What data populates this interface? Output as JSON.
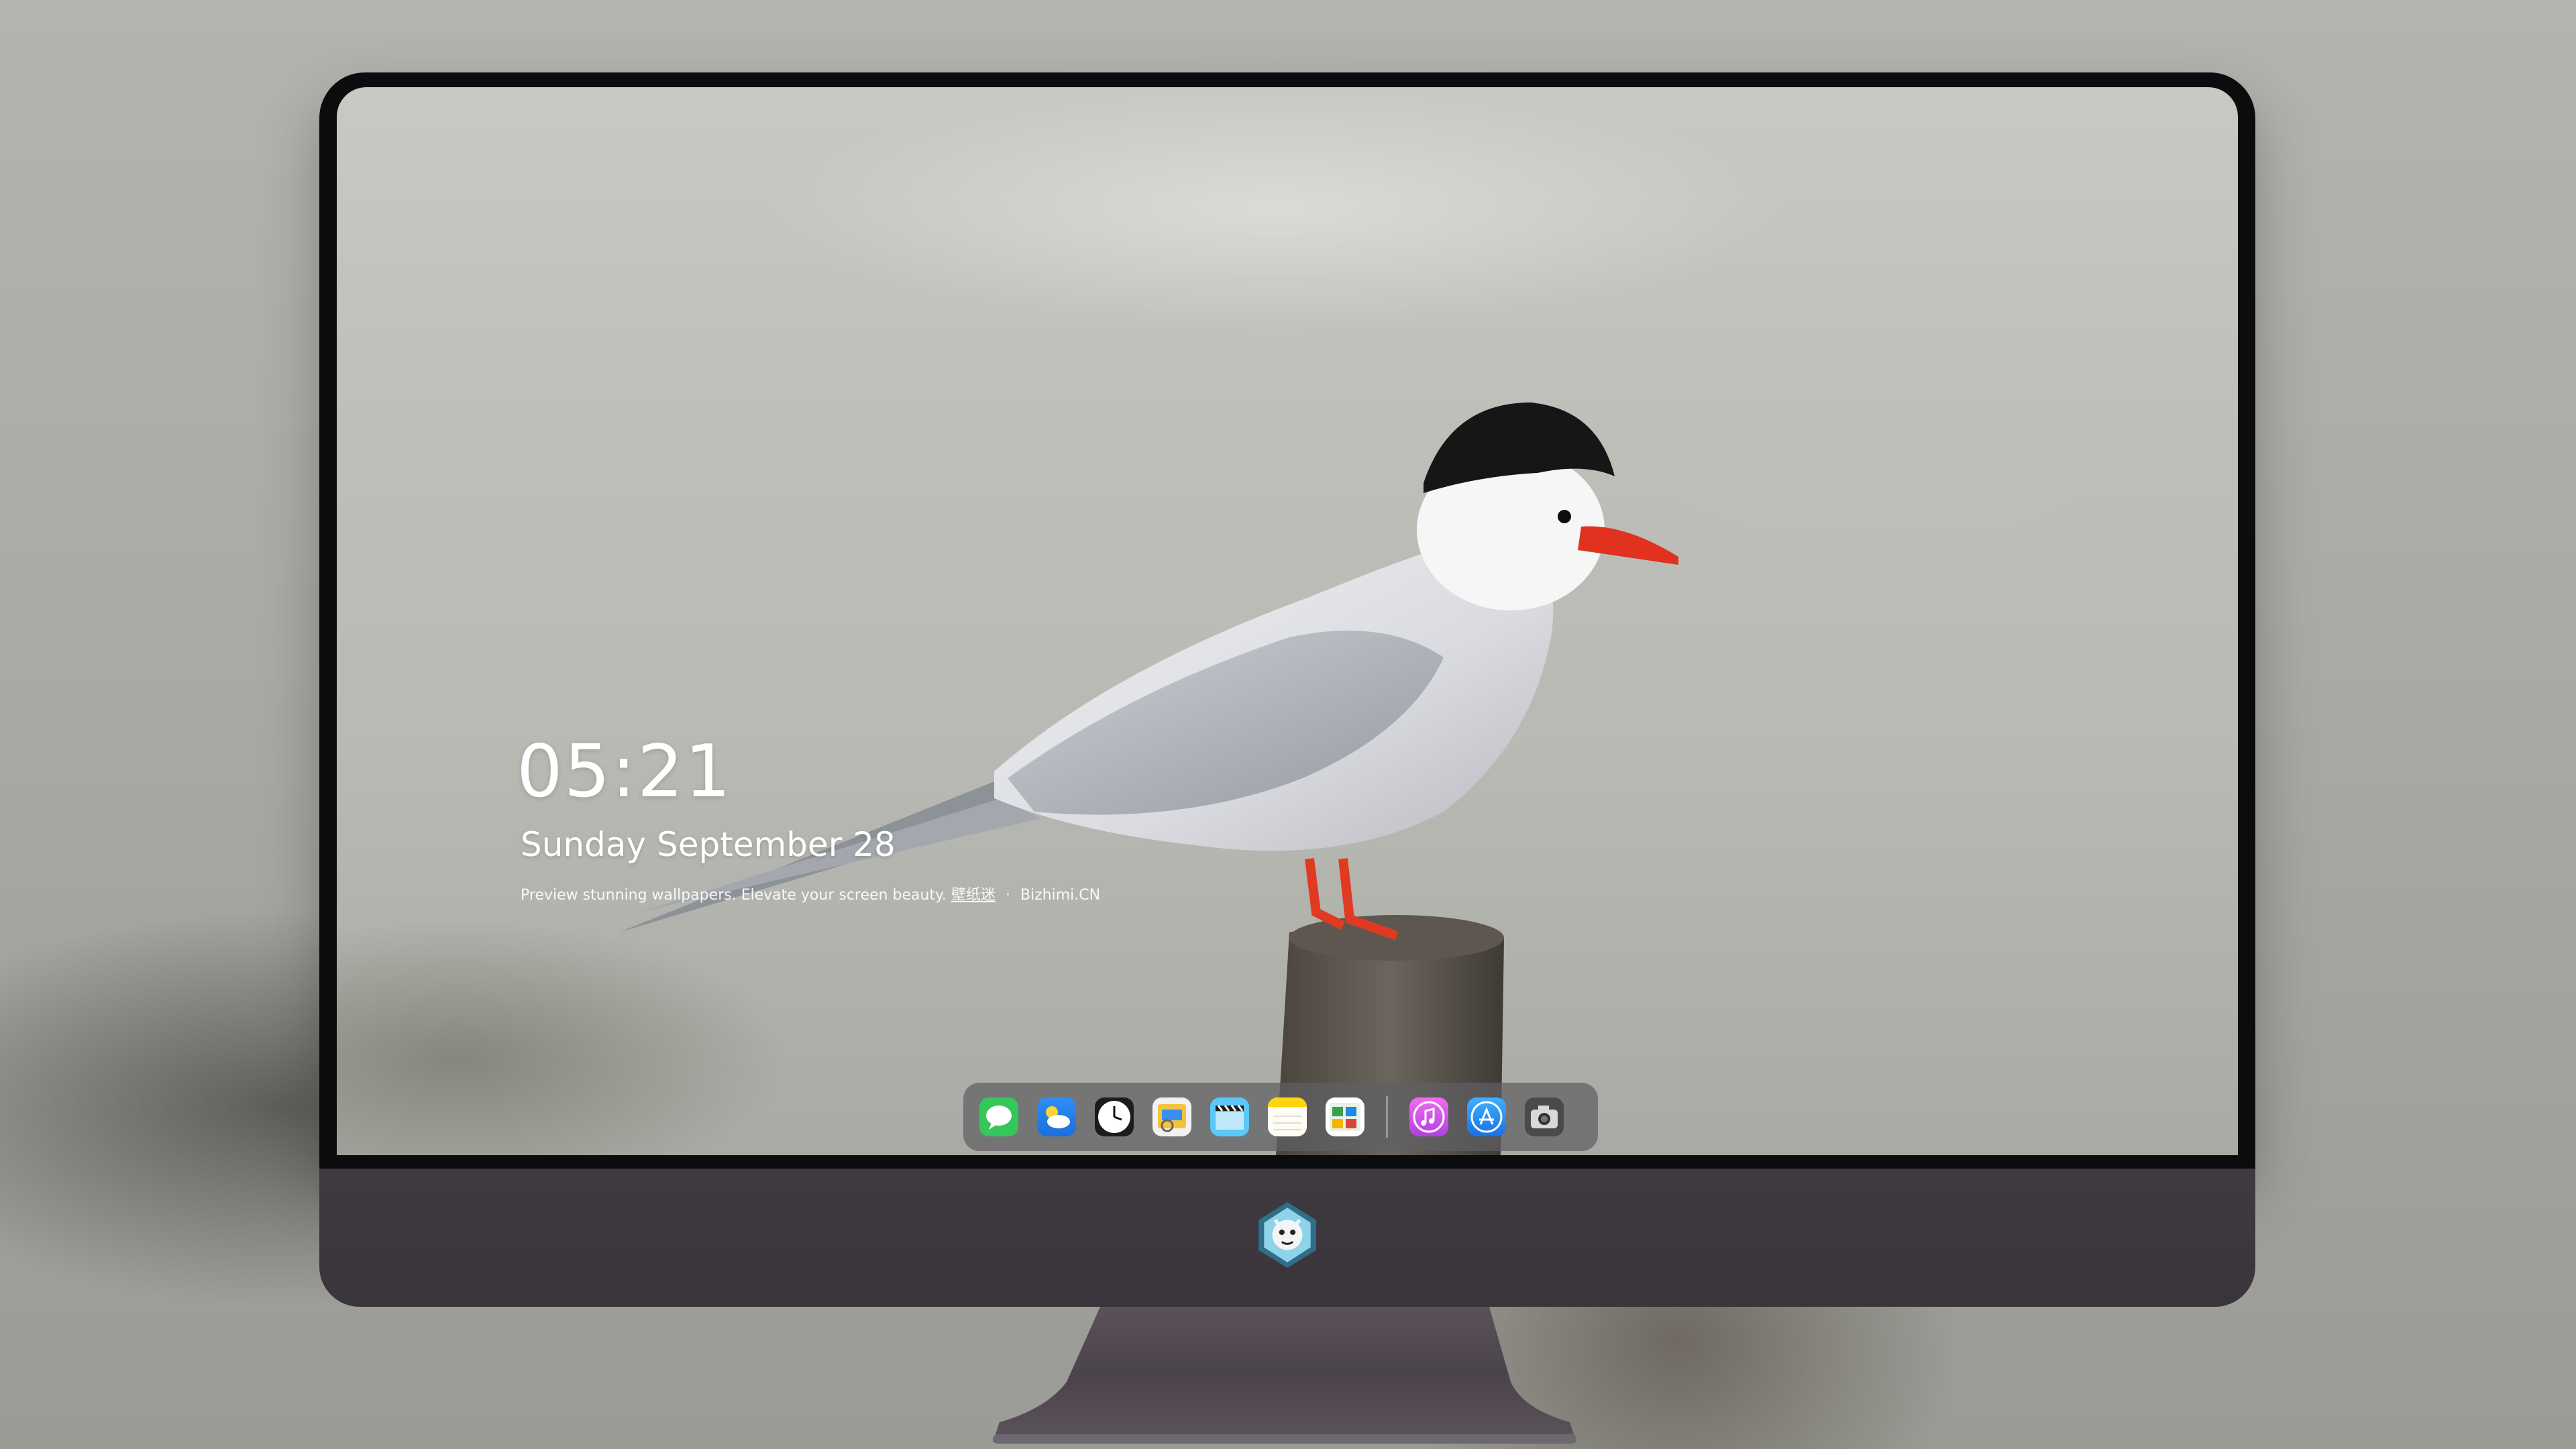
{
  "lockscreen": {
    "time": "05:21",
    "date": "Sunday September  28",
    "caption_text": "Preview stunning wallpapers. Elevate your screen beauty.",
    "caption_link": "壁纸迷",
    "caption_site": "Bizhimi.CN"
  },
  "dock": {
    "apps": [
      {
        "name": "Messages",
        "icon": "messages-icon",
        "color": "#34c759"
      },
      {
        "name": "Weather",
        "icon": "weather-icon",
        "color": "#1e90ff"
      },
      {
        "name": "Clock",
        "icon": "clock-icon",
        "color": "#1c1c1e"
      },
      {
        "name": "Preview",
        "icon": "preview-icon",
        "color": "#f3c33a"
      },
      {
        "name": "Clips",
        "icon": "clapperboard-icon",
        "color": "#5ac8fa"
      },
      {
        "name": "Notes",
        "icon": "notes-icon",
        "color": "#ffd60a"
      },
      {
        "name": "Calendar",
        "icon": "calendar-icon",
        "color": "#3aa04a"
      },
      {
        "name": "iTunes",
        "icon": "music-icon",
        "color": "#d84ef0"
      },
      {
        "name": "App Store",
        "icon": "app-store-icon",
        "color": "#1a8cff"
      },
      {
        "name": "Camera",
        "icon": "camera-icon",
        "color": "#4a4a4c"
      }
    ]
  },
  "colors": {
    "bezel": "#0c0c0e",
    "chin": "#3c373d",
    "dock_bg": "#5f5f62"
  }
}
